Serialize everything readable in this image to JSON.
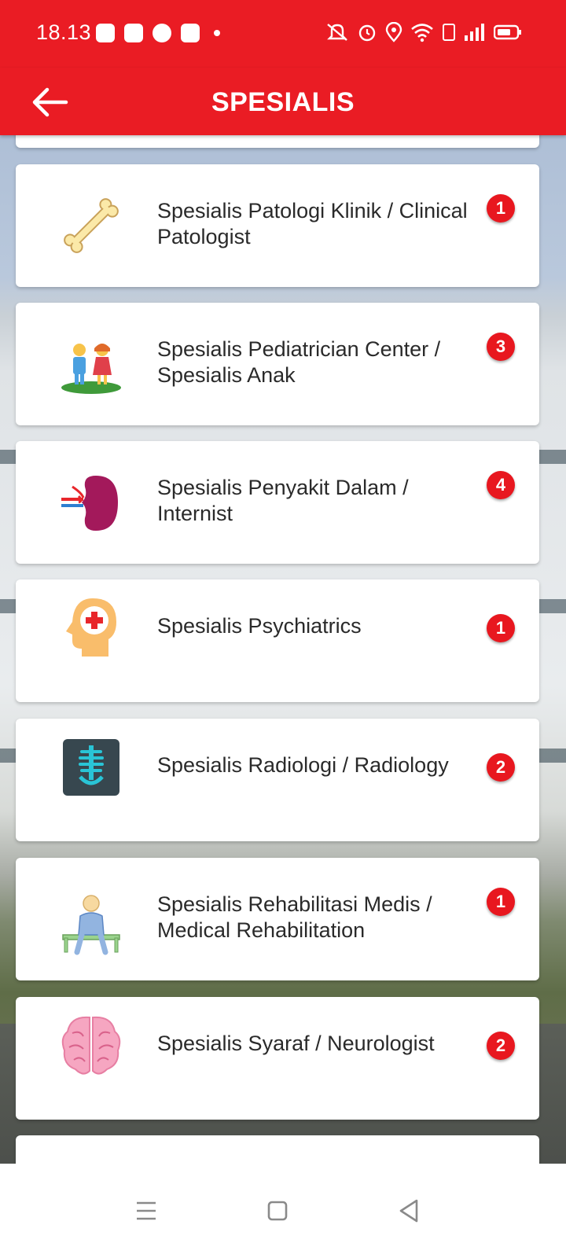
{
  "status_bar": {
    "time": "18.13",
    "notification_icons": [
      "line-icon",
      "discord-icon",
      "chat-icon",
      "facebook-icon",
      "dot-icon"
    ],
    "system_icons": [
      "mute-icon",
      "alarm-icon",
      "location-icon",
      "wifi-icon",
      "volte-icon",
      "signal-icon",
      "battery-icon"
    ]
  },
  "app_bar": {
    "title": "SPESIALIS",
    "back_icon": "arrow-left-icon"
  },
  "colors": {
    "primary": "#ea1c24",
    "badge": "#e8171f",
    "card": "#ffffff",
    "text": "#2a2a2a"
  },
  "specialists": [
    {
      "title": "Spesialis Patologi Klinik / Clinical Patologist",
      "count": "1",
      "icon": "bone-icon"
    },
    {
      "title": "Spesialis Pediatrician Center / Spesialis Anak",
      "count": "3",
      "icon": "children-icon"
    },
    {
      "title": "Spesialis Penyakit Dalam / Internist",
      "count": "4",
      "icon": "kidney-icon"
    },
    {
      "title": "Spesialis Psychiatrics",
      "count": "1",
      "icon": "mental-health-icon"
    },
    {
      "title": "Spesialis Radiologi / Radiology",
      "count": "2",
      "icon": "xray-icon"
    },
    {
      "title": "Spesialis Rehabilitasi Medis / Medical Rehabilitation",
      "count": "1",
      "icon": "sitting-person-icon"
    },
    {
      "title": "Spesialis Syaraf / Neurologist",
      "count": "2",
      "icon": "brain-icon"
    }
  ],
  "nav_bar": {
    "buttons": [
      "menu-icon",
      "home-icon",
      "back-triangle-icon"
    ]
  }
}
